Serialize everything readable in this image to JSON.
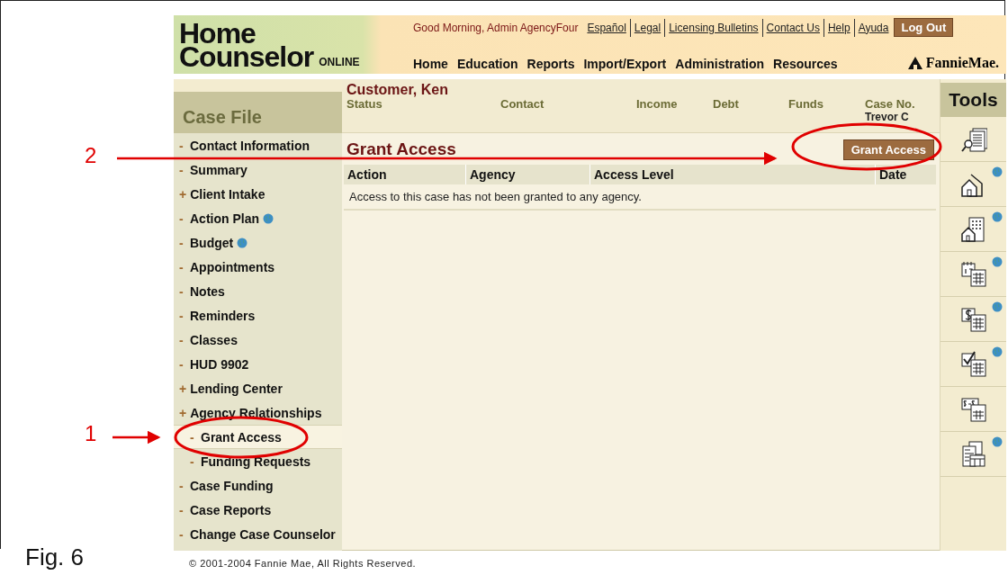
{
  "header": {
    "logo_line1": "Home",
    "logo_line2": "Counselor",
    "logo_suffix": "ONLINE",
    "greeting": "Good Morning, Admin AgencyFour",
    "links": [
      "Español",
      "Legal",
      "Licensing Bulletins",
      "Contact Us",
      "Help",
      "Ayuda"
    ],
    "logout": "Log Out",
    "nav": [
      "Home",
      "Education",
      "Reports",
      "Import/Export",
      "Administration",
      "Resources"
    ],
    "brand": "FannieMae."
  },
  "sidebar": {
    "title": "Case File",
    "items": [
      {
        "marker": "-",
        "label": "Contact Information",
        "selected": false,
        "globe": false
      },
      {
        "marker": "-",
        "label": "Summary",
        "selected": false,
        "globe": false
      },
      {
        "marker": "+",
        "label": "Client Intake",
        "selected": false,
        "globe": false
      },
      {
        "marker": "-",
        "label": "Action Plan",
        "selected": false,
        "globe": true
      },
      {
        "marker": "-",
        "label": "Budget",
        "selected": false,
        "globe": true
      },
      {
        "marker": "-",
        "label": "Appointments",
        "selected": false,
        "globe": false
      },
      {
        "marker": "-",
        "label": "Notes",
        "selected": false,
        "globe": false
      },
      {
        "marker": "-",
        "label": "Reminders",
        "selected": false,
        "globe": false
      },
      {
        "marker": "-",
        "label": "Classes",
        "selected": false,
        "globe": false
      },
      {
        "marker": "-",
        "label": "HUD 9902",
        "selected": false,
        "globe": false
      },
      {
        "marker": "+",
        "label": "Lending Center",
        "selected": false,
        "globe": false
      },
      {
        "marker": "+",
        "label": "Agency Relationships",
        "selected": false,
        "globe": false,
        "children": [
          {
            "marker": "-",
            "label": "Grant Access",
            "selected": true,
            "globe": false
          },
          {
            "marker": "-",
            "label": "Funding Requests",
            "selected": false,
            "globe": false
          }
        ]
      },
      {
        "marker": "-",
        "label": "Case Funding",
        "selected": false,
        "globe": false
      },
      {
        "marker": "-",
        "label": "Case Reports",
        "selected": false,
        "globe": false
      },
      {
        "marker": "-",
        "label": "Change Case Counselor",
        "selected": false,
        "globe": false
      }
    ]
  },
  "case_header": {
    "customer": "Customer, Ken",
    "columns": [
      "Status",
      "Contact",
      "Income",
      "Debt",
      "Funds",
      "Case No."
    ],
    "case_value": "Trevor C"
  },
  "section": {
    "title": "Grant Access",
    "button": "Grant Access",
    "table": {
      "columns": [
        "Action",
        "Agency",
        "Access Level",
        "Date"
      ],
      "empty_message": "Access to this case has not been granted to any agency."
    }
  },
  "tools": {
    "title": "Tools",
    "items": [
      {
        "kind": "document-search",
        "globe": false
      },
      {
        "kind": "houses",
        "globe": true
      },
      {
        "kind": "building",
        "globe": true
      },
      {
        "kind": "calendar",
        "globe": true
      },
      {
        "kind": "dollar",
        "globe": true
      },
      {
        "kind": "checklist",
        "globe": true
      },
      {
        "kind": "transfer",
        "globe": false
      },
      {
        "kind": "forms",
        "globe": true
      }
    ]
  },
  "footer": {
    "copyright": "© 2001-2004 Fannie Mae, All Rights Reserved."
  },
  "figure_label": "Fig. 6",
  "annotations": [
    {
      "label": "2"
    },
    {
      "label": "1"
    }
  ]
}
